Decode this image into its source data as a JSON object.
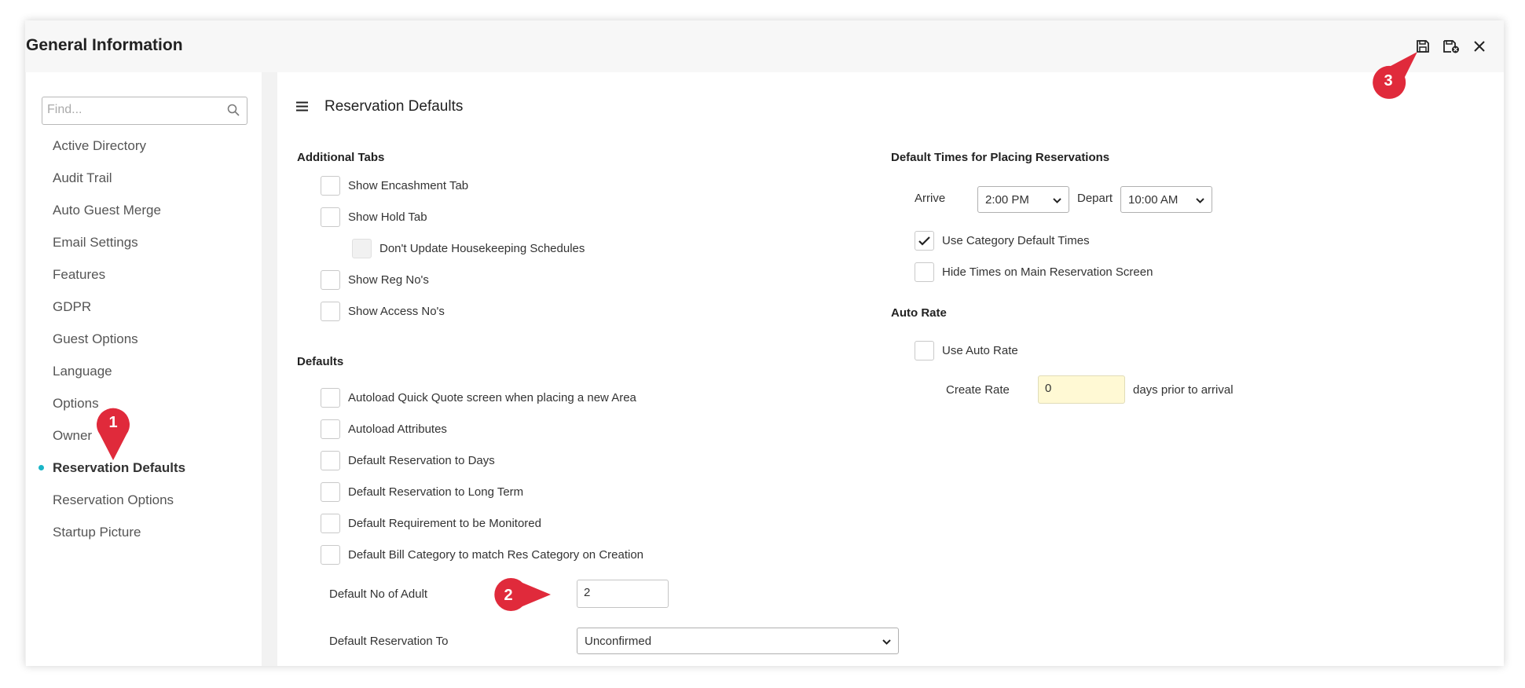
{
  "window": {
    "title": "General Information"
  },
  "toolbar": {
    "save_icon": "save-icon",
    "save_close_icon": "save-close-icon",
    "close_icon": "close-icon"
  },
  "sidebar": {
    "search_placeholder": "Find...",
    "items": [
      {
        "label": "Active Directory"
      },
      {
        "label": "Audit Trail"
      },
      {
        "label": "Auto Guest Merge"
      },
      {
        "label": "Email Settings"
      },
      {
        "label": "Features"
      },
      {
        "label": "GDPR"
      },
      {
        "label": "Guest Options"
      },
      {
        "label": "Language"
      },
      {
        "label": "Options"
      },
      {
        "label": "Owner"
      },
      {
        "label": "Reservation Defaults",
        "active": true
      },
      {
        "label": "Reservation Options"
      },
      {
        "label": "Startup Picture"
      }
    ]
  },
  "main": {
    "title": "Reservation Defaults",
    "additional_tabs": {
      "heading": "Additional Tabs",
      "items": [
        {
          "label": "Show Encashment Tab",
          "checked": false
        },
        {
          "label": "Show Hold Tab",
          "checked": false
        },
        {
          "label": "Don't Update Housekeeping Schedules",
          "checked": false,
          "disabled": true
        },
        {
          "label": "Show Reg No's",
          "checked": false
        },
        {
          "label": "Show Access No's",
          "checked": false
        }
      ]
    },
    "defaults": {
      "heading": "Defaults",
      "items": [
        {
          "label": "Autoload Quick Quote screen when placing a new Area",
          "checked": false
        },
        {
          "label": "Autoload Attributes",
          "checked": false
        },
        {
          "label": "Default Reservation to Days",
          "checked": false
        },
        {
          "label": "Default Reservation to Long Term",
          "checked": false
        },
        {
          "label": "Default Requirement to be Monitored",
          "checked": false
        },
        {
          "label": "Default Bill Category to match Res Category on Creation",
          "checked": false
        }
      ],
      "adult_label": "Default No of Adult",
      "adult_value": "2",
      "res_to_label": "Default Reservation To",
      "res_to_value": "Unconfirmed"
    },
    "default_times": {
      "heading": "Default Times for Placing Reservations",
      "arrive_label": "Arrive",
      "arrive_value": "2:00 PM",
      "depart_label": "Depart",
      "depart_value": "10:00 AM",
      "items": [
        {
          "label": "Use Category Default Times",
          "checked": true
        },
        {
          "label": "Hide Times on Main Reservation Screen",
          "checked": false
        }
      ]
    },
    "auto_rate": {
      "heading": "Auto Rate",
      "use_label": "Use Auto Rate",
      "use_checked": false,
      "create_label": "Create Rate",
      "create_value": "0",
      "create_suffix": "days prior to arrival"
    }
  },
  "annotations": {
    "marker1": "1",
    "marker2": "2",
    "marker3": "3",
    "color": "#e02a3b"
  }
}
